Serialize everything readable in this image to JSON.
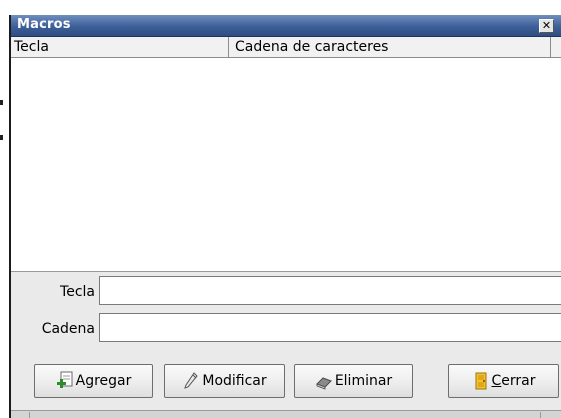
{
  "window": {
    "title": "Macros",
    "close_glyph": "✕"
  },
  "table": {
    "columns": [
      "Tecla",
      "Cadena de caracteres"
    ],
    "rows": []
  },
  "form": {
    "key_label": "Tecla",
    "key_value": "",
    "string_label": "Cadena",
    "string_value": ""
  },
  "buttons": {
    "add": "Agregar",
    "modify": "Modificar",
    "delete": "Eliminar",
    "close": "Cerrar"
  },
  "icons": {
    "add": "add-document-icon",
    "modify": "pencil-icon",
    "delete": "eraser-icon",
    "close": "exit-door-icon"
  },
  "colors": {
    "titlebar": "#3d5f98",
    "window_bg": "#eaeaea",
    "table_bg": "#ffffff"
  }
}
